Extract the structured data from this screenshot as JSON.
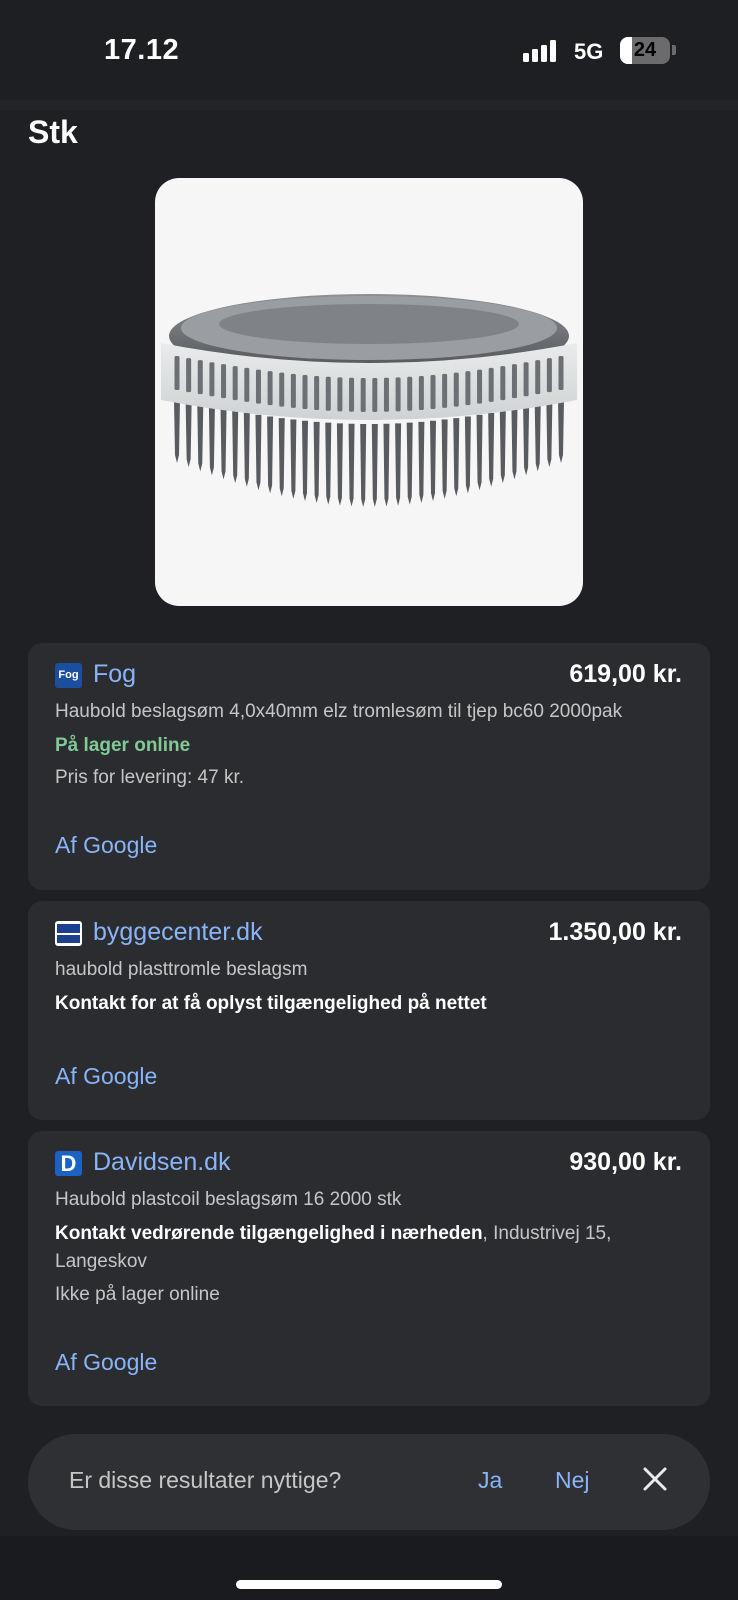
{
  "status_bar": {
    "time": "17.12",
    "network": "5G",
    "battery": "24",
    "battery_level_percent": 24
  },
  "section_title": "Stk",
  "offers": [
    {
      "store": "Fog",
      "favicon": "fog-logo-icon",
      "favicon_text": "Fog",
      "price": "619,00 kr.",
      "title": "Haubold beslagsøm 4,0x40mm elz tromlesøm til tjep bc60 2000pak",
      "availability": "På lager online",
      "delivery": "Pris for levering: 47 kr.",
      "source": "Af Google"
    },
    {
      "store": "byggecenter.dk",
      "favicon": "byggecenter-logo-icon",
      "price": "1.350,00 kr.",
      "title": "haubold plasttromle beslagsm",
      "availability": "Kontakt for at få oplyst tilgængelighed på nettet",
      "source": "Af Google"
    },
    {
      "store": "Davidsen.dk",
      "favicon": "davidsen-logo-icon",
      "favicon_text": "D",
      "price": "930,00 kr.",
      "title": "Haubold plastcoil beslagsøm 16 2000 stk",
      "availability": "Kontakt vedrørende tilgængelighed i nærheden",
      "address": ", Industrivej 15,",
      "address_line2": "Langeskov",
      "stock": "Ikke på lager online",
      "source": "Af Google"
    }
  ],
  "feedback": {
    "question": "Er disse resultater nyttige?",
    "yes": "Ja",
    "no": "Nej",
    "close_icon": "close-icon"
  },
  "colors": {
    "link": "#8ab4f8",
    "in_stock": "#81c995",
    "card_bg": "#2b2c30",
    "page_bg": "#1f2023"
  }
}
